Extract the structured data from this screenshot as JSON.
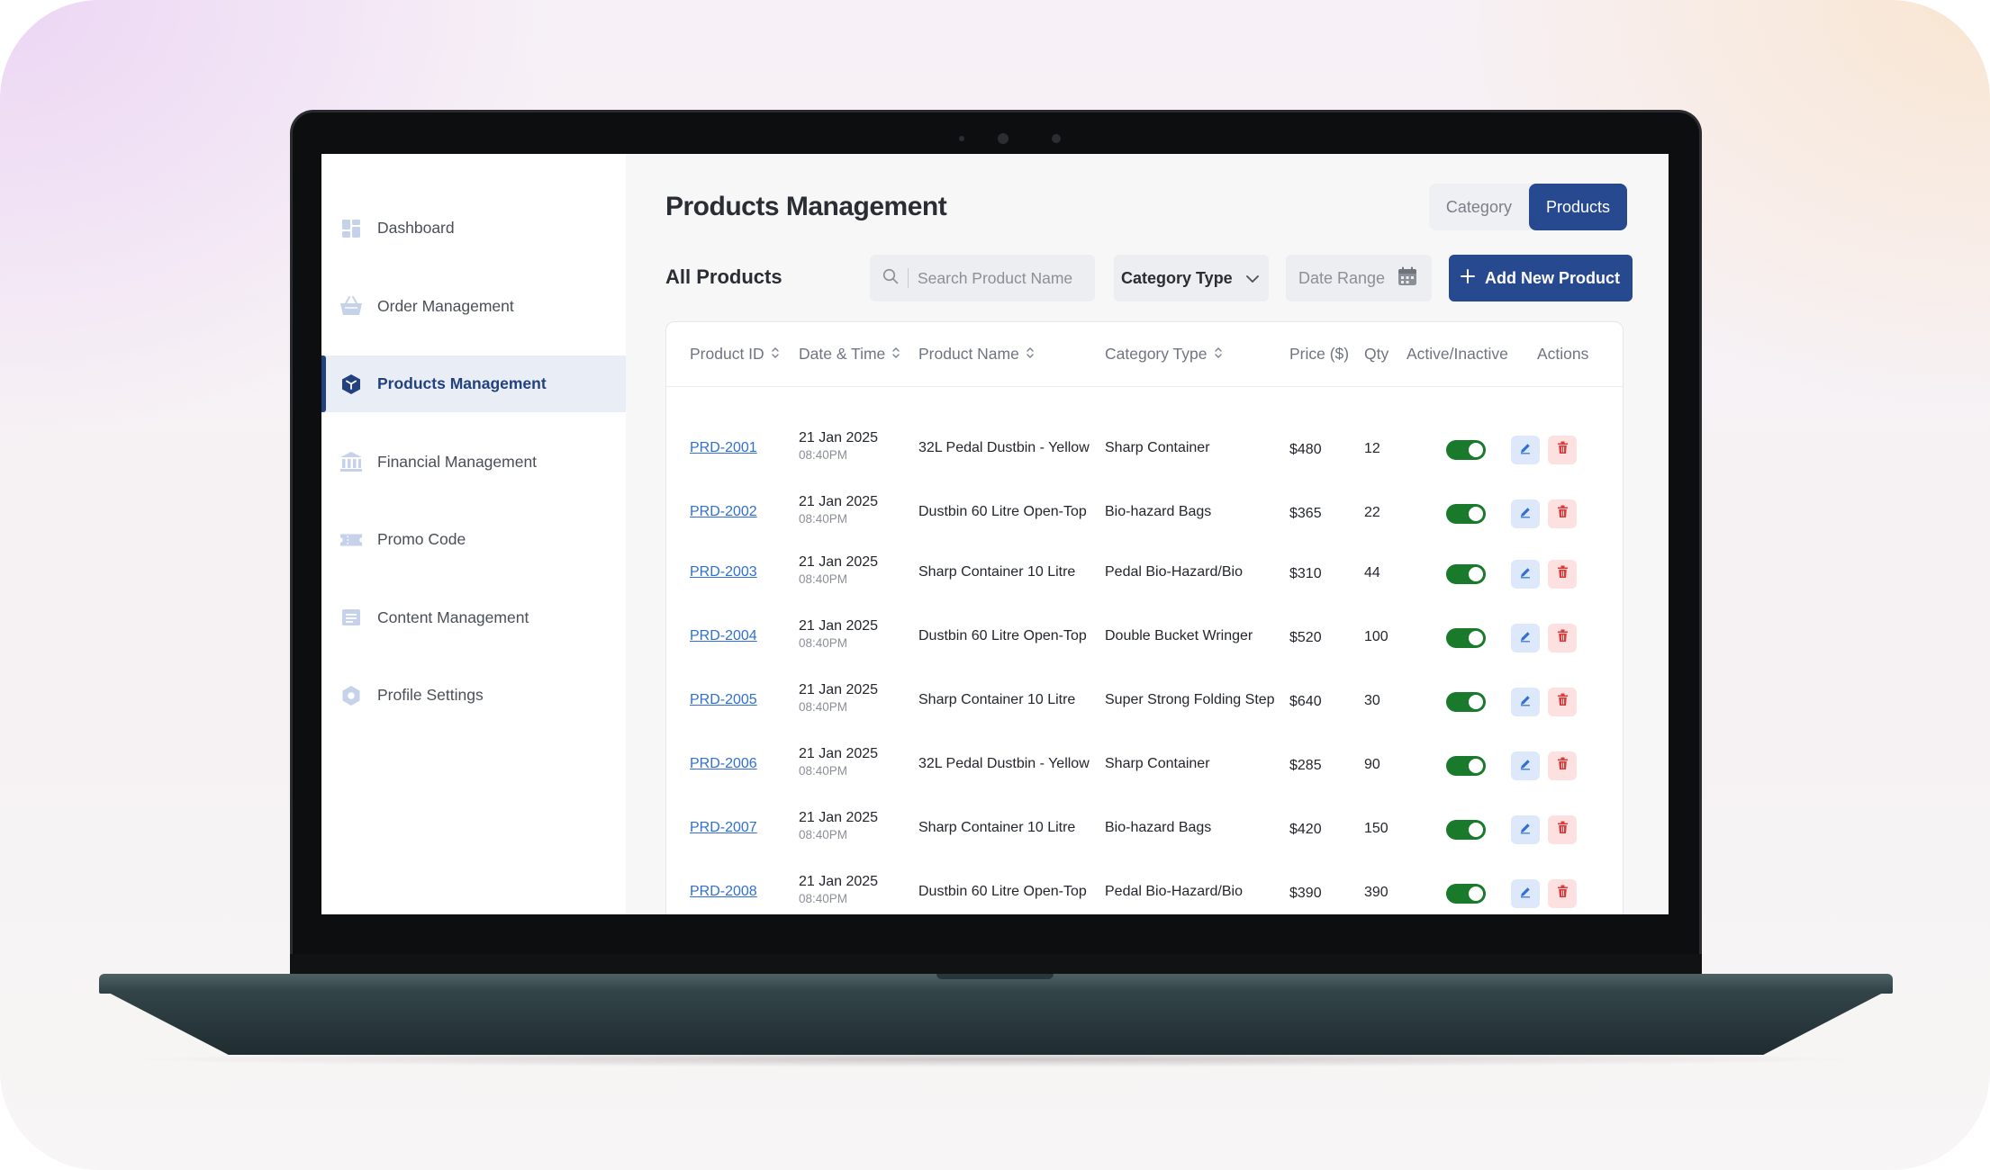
{
  "sidebar": {
    "items": [
      {
        "label": "Dashboard",
        "icon": "dashboard-icon",
        "active": false
      },
      {
        "label": "Order Management",
        "icon": "basket-icon",
        "active": false
      },
      {
        "label": "Products Management",
        "icon": "box-icon",
        "active": true
      },
      {
        "label": "Financial Management",
        "icon": "bank-icon",
        "active": false
      },
      {
        "label": "Promo Code",
        "icon": "ticket-icon",
        "active": false
      },
      {
        "label": "Content Management",
        "icon": "document-icon",
        "active": false
      },
      {
        "label": "Profile Settings",
        "icon": "gear-icon",
        "active": false
      }
    ]
  },
  "header": {
    "title": "Products Management",
    "toggle": {
      "category": "Category",
      "products": "Products",
      "selected": "Products"
    }
  },
  "toolbar": {
    "section_title": "All Products",
    "search_placeholder": "Search Product Name",
    "category_select": "Category Type",
    "date_range": "Date Range",
    "add_button": "Add New Product"
  },
  "table": {
    "columns": [
      "Product ID",
      "Date & Time",
      "Product Name",
      "Category Type",
      "Price ($)",
      "Qty",
      "Active/Inactive",
      "Actions"
    ],
    "rows": [
      {
        "id": "PRD-2001",
        "date": "21 Jan 2025",
        "time": "08:40PM",
        "name": "32L Pedal Dustbin - Yellow",
        "category": "Sharp Container",
        "price": "$480",
        "qty": "12",
        "active": true
      },
      {
        "id": "PRD-2002",
        "date": "21 Jan 2025",
        "time": "08:40PM",
        "name": "Dustbin 60 Litre Open-Top",
        "category": "Bio-hazard Bags",
        "price": "$365",
        "qty": "22",
        "active": true
      },
      {
        "id": "PRD-2003",
        "date": "21 Jan 2025",
        "time": "08:40PM",
        "name": "Sharp Container 10 Litre",
        "category": "Pedal Bio-Hazard/Bio",
        "price": "$310",
        "qty": "44",
        "active": true
      },
      {
        "id": "PRD-2004",
        "date": "21 Jan 2025",
        "time": "08:40PM",
        "name": "Dustbin 60 Litre Open-Top",
        "category": "Double Bucket Wringer",
        "price": "$520",
        "qty": "100",
        "active": true
      },
      {
        "id": "PRD-2005",
        "date": "21 Jan 2025",
        "time": "08:40PM",
        "name": "Sharp Container 10 Litre",
        "category": "Super Strong Folding Step",
        "price": "$640",
        "qty": "30",
        "active": true
      },
      {
        "id": "PRD-2006",
        "date": "21 Jan 2025",
        "time": "08:40PM",
        "name": "32L Pedal Dustbin - Yellow",
        "category": "Sharp Container",
        "price": "$285",
        "qty": "90",
        "active": true
      },
      {
        "id": "PRD-2007",
        "date": "21 Jan 2025",
        "time": "08:40PM",
        "name": "Sharp Container 10 Litre",
        "category": "Bio-hazard Bags",
        "price": "$420",
        "qty": "150",
        "active": true
      },
      {
        "id": "PRD-2008",
        "date": "21 Jan 2025",
        "time": "08:40PM",
        "name": "Dustbin 60 Litre Open-Top",
        "category": "Pedal Bio-Hazard/Bio",
        "price": "$390",
        "qty": "390",
        "active": true
      }
    ]
  },
  "colors": {
    "primary": "#27498f",
    "link": "#2f6fd6",
    "toggle_on": "#1a7a2b",
    "delete": "#d93a3a"
  }
}
